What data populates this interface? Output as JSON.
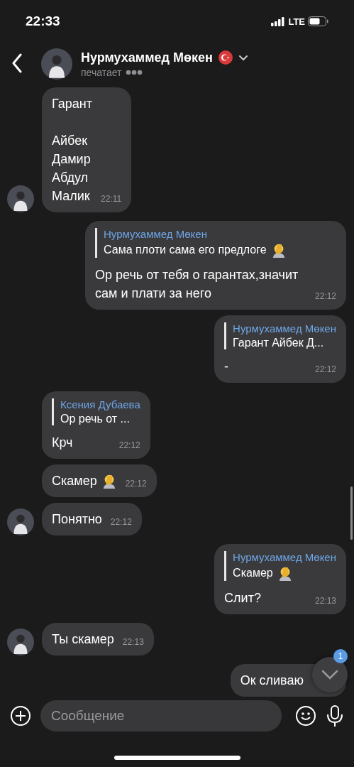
{
  "status_bar": {
    "time": "22:33",
    "network": "LTE"
  },
  "header": {
    "name": "Нурмухаммед Мөкен",
    "status": "печатает"
  },
  "messages": [
    {
      "kind": "incoming",
      "avatar": true,
      "text": "Гарант\n\nАйбек\nДамир\nАбдул\nМалик",
      "time": "22:11"
    },
    {
      "kind": "outgoing",
      "reply": {
        "name": "Нурмухаммед Мөкен",
        "text": "Сама плоти сама его предлоге",
        "emoji": true
      },
      "text": "Ор речь от тебя о гарантах,значит сам и плати за него",
      "time": "22:12"
    },
    {
      "kind": "outgoing",
      "reply": {
        "name": "Нурмухаммед Мөкен",
        "text": "Гарант Айбек Д..."
      },
      "text": "-",
      "time": "22:12"
    },
    {
      "kind": "incoming",
      "avatar": false,
      "reply": {
        "name": "Ксения Дубаева",
        "text": "Ор речь от ..."
      },
      "text": "Крч",
      "time": "22:12"
    },
    {
      "kind": "incoming",
      "avatar": false,
      "text": "Скамер",
      "emoji": true,
      "time": "22:12"
    },
    {
      "kind": "incoming",
      "avatar": true,
      "text": "Понятно",
      "time": "22:12"
    },
    {
      "kind": "outgoing",
      "reply": {
        "name": "Нурмухаммед Мөкен",
        "text": "Скамер",
        "emoji": true
      },
      "text": "Слит?",
      "time": "22:13"
    },
    {
      "kind": "incoming",
      "avatar": true,
      "text": "Ты скамер",
      "time": "22:13"
    },
    {
      "kind": "outgoing",
      "text": "Ок сливаю"
    }
  ],
  "scroll_button": {
    "badge": "1"
  },
  "composer": {
    "placeholder": "Сообщение"
  }
}
